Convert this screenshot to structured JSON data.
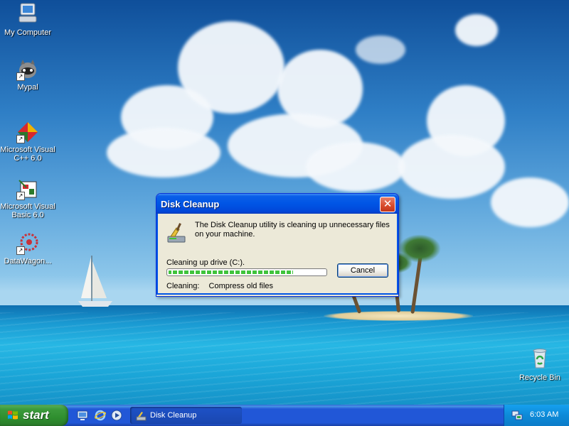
{
  "desktop": {
    "icons": [
      {
        "label": "My Computer",
        "icon": "my-computer-icon"
      },
      {
        "label": "Mypal",
        "icon": "mypal-icon"
      },
      {
        "label": "Microsoft Visual C++ 6.0",
        "icon": "visual-cpp-icon"
      },
      {
        "label": "Microsoft Visual Basic 6.0",
        "icon": "visual-basic-icon"
      },
      {
        "label": "DataWagon...",
        "icon": "datawagon-icon"
      },
      {
        "label": "Recycle Bin",
        "icon": "recycle-bin-icon"
      }
    ]
  },
  "dialog": {
    "title": "Disk Cleanup",
    "close_symbol": "✕",
    "message": "The Disk Cleanup utility is cleaning up unnecessary files on your machine.",
    "status": "Cleaning up drive  (C:).",
    "progress": 0.8,
    "cancel_label": "Cancel",
    "task_label": "Cleaning:",
    "task_value": "Compress old files"
  },
  "taskbar": {
    "start_label": "start",
    "quick_launch": [
      "show-desktop-icon",
      "internet-explorer-icon",
      "media-player-icon"
    ],
    "task_label": "Disk Cleanup",
    "clock": "6:03 AM"
  },
  "colors": {
    "titlebar": "#0055e5",
    "start_green": "#3c9b3c",
    "progress_green": "#3fc33b",
    "dialog_bg": "#ece9d8"
  }
}
